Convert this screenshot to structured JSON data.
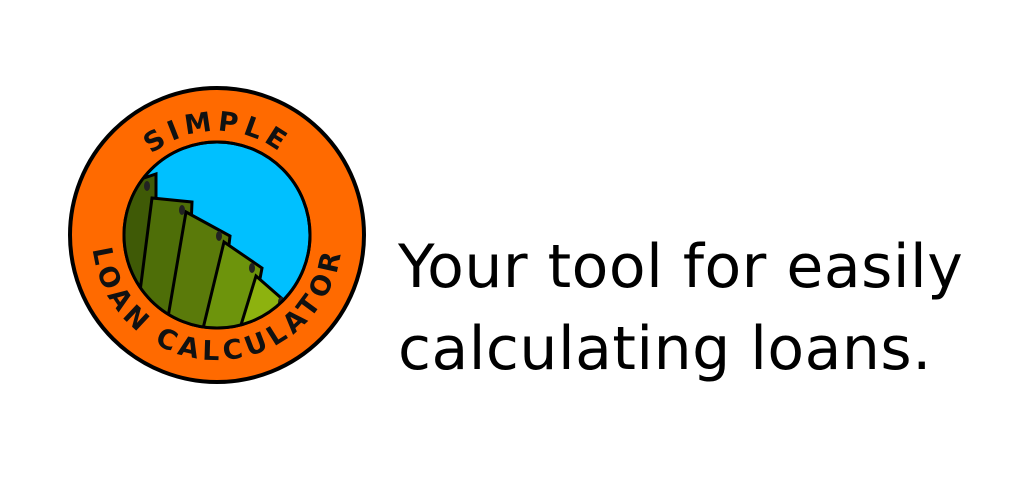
{
  "logo": {
    "name": "Simple Loan Calculator",
    "top_word": "SIMPLE",
    "bottom_words": "LOAN CALCULATOR",
    "icon": "money-stack-icon",
    "colors": {
      "ring": "#ff6a00",
      "sky": "#00c0ff",
      "outline": "#000000",
      "bill_dark": "#3f5a06",
      "bill_mid": "#5a7a0a",
      "bill_light": "#8db20f"
    }
  },
  "tagline": {
    "line1": "Your tool for easily",
    "line2": "calculating loans."
  }
}
